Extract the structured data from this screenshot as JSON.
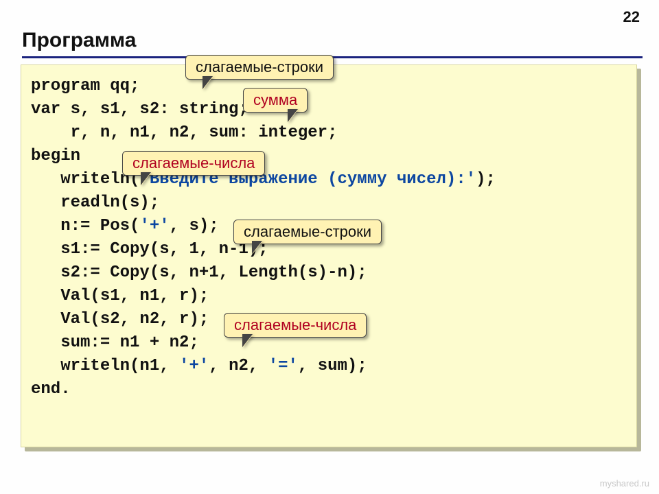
{
  "page_number": "22",
  "title": "Программа",
  "code": {
    "l1": "program qq;",
    "l2": "var s, s1, s2: string;",
    "l3": "    r, n, n1, n2, sum: integer;",
    "l4": "begin",
    "l5a": "   writeln(",
    "l5b": "'Введите выражение (сумму чисел):'",
    "l5c": ");",
    "l6": "   readln(s);",
    "l7a": "   n:= Pos(",
    "l7b": "'+'",
    "l7c": ", s);",
    "l8": "   s1:= Copy(s, 1, n-1);",
    "l9": "   s2:= Copy(s, n+1, Length(s)-n);",
    "l10": "   Val(s1, n1, r);",
    "l11": "   Val(s2, n2, r);",
    "l12": "   sum:= n1 + n2;",
    "l13a": "   writeln(n1, ",
    "l13b": "'+'",
    "l13c": ", n2, ",
    "l13d": "'='",
    "l13e": ", sum);",
    "l14": "end."
  },
  "callouts": {
    "c1": "слагаемые-строки",
    "c2": "сумма",
    "c3": "слагаемые-числа",
    "c4": "слагаемые-строки",
    "c5": "слагаемые-числа"
  },
  "watermark": "myshared.ru"
}
